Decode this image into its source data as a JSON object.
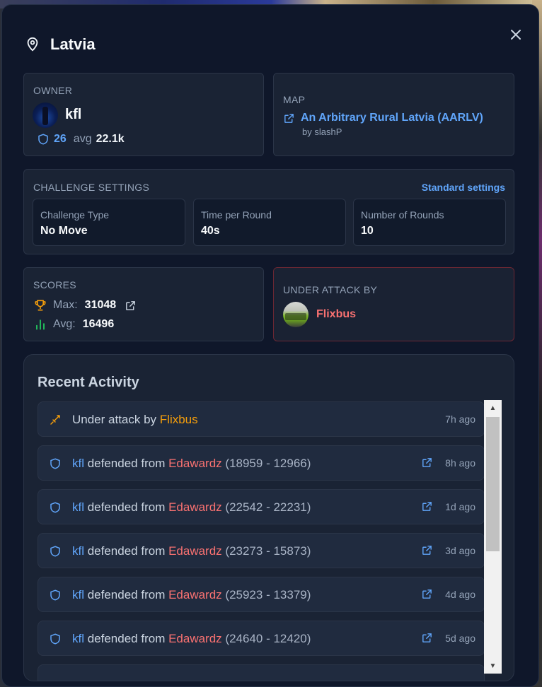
{
  "title": "Latvia",
  "owner": {
    "label": "OWNER",
    "name": "kfl",
    "defenses": "26",
    "avg_label": "avg",
    "avg_value": "22.1k"
  },
  "map": {
    "label": "MAP",
    "name": "An Arbitrary Rural Latvia (AARLV)",
    "author": "by slashP"
  },
  "challenge": {
    "label": "CHALLENGE SETTINGS",
    "standard_link": "Standard settings",
    "settings": [
      {
        "label": "Challenge Type",
        "value": "No Move"
      },
      {
        "label": "Time per Round",
        "value": "40s"
      },
      {
        "label": "Number of Rounds",
        "value": "10"
      }
    ]
  },
  "scores": {
    "label": "SCORES",
    "max_label": "Max:",
    "max_value": "31048",
    "avg_label": "Avg:",
    "avg_value": "16496"
  },
  "attack": {
    "label": "UNDER ATTACK BY",
    "attacker": "Flixbus"
  },
  "activity": {
    "title": "Recent Activity",
    "items": [
      {
        "type": "attack",
        "prefix": "Under attack by ",
        "name": "Flixbus",
        "time": "7h ago"
      },
      {
        "type": "defend",
        "user": "kfl",
        "verb": " defended from ",
        "foe": "Edawardz",
        "score": " (18959 - 12966)",
        "time": "8h ago"
      },
      {
        "type": "defend",
        "user": "kfl",
        "verb": " defended from ",
        "foe": "Edawardz",
        "score": " (22542 - 22231)",
        "time": "1d ago"
      },
      {
        "type": "defend",
        "user": "kfl",
        "verb": " defended from ",
        "foe": "Edawardz",
        "score": " (23273 - 15873)",
        "time": "3d ago"
      },
      {
        "type": "defend",
        "user": "kfl",
        "verb": " defended from ",
        "foe": "Edawardz",
        "score": " (25923 - 13379)",
        "time": "4d ago"
      },
      {
        "type": "defend",
        "user": "kfl",
        "verb": " defended from ",
        "foe": "Edawardz",
        "score": " (24640 - 12420)",
        "time": "5d ago"
      }
    ]
  },
  "colors": {
    "accent_blue": "#60a5fa",
    "danger_red": "#f87171",
    "warning_orange": "#f59e0b",
    "success_green": "#22c55e",
    "panel_bg": "#0f172a"
  },
  "icons": [
    "map-pin-icon",
    "close-icon",
    "shield-icon",
    "external-link-icon",
    "trophy-icon",
    "bar-chart-icon",
    "sword-icon"
  ]
}
